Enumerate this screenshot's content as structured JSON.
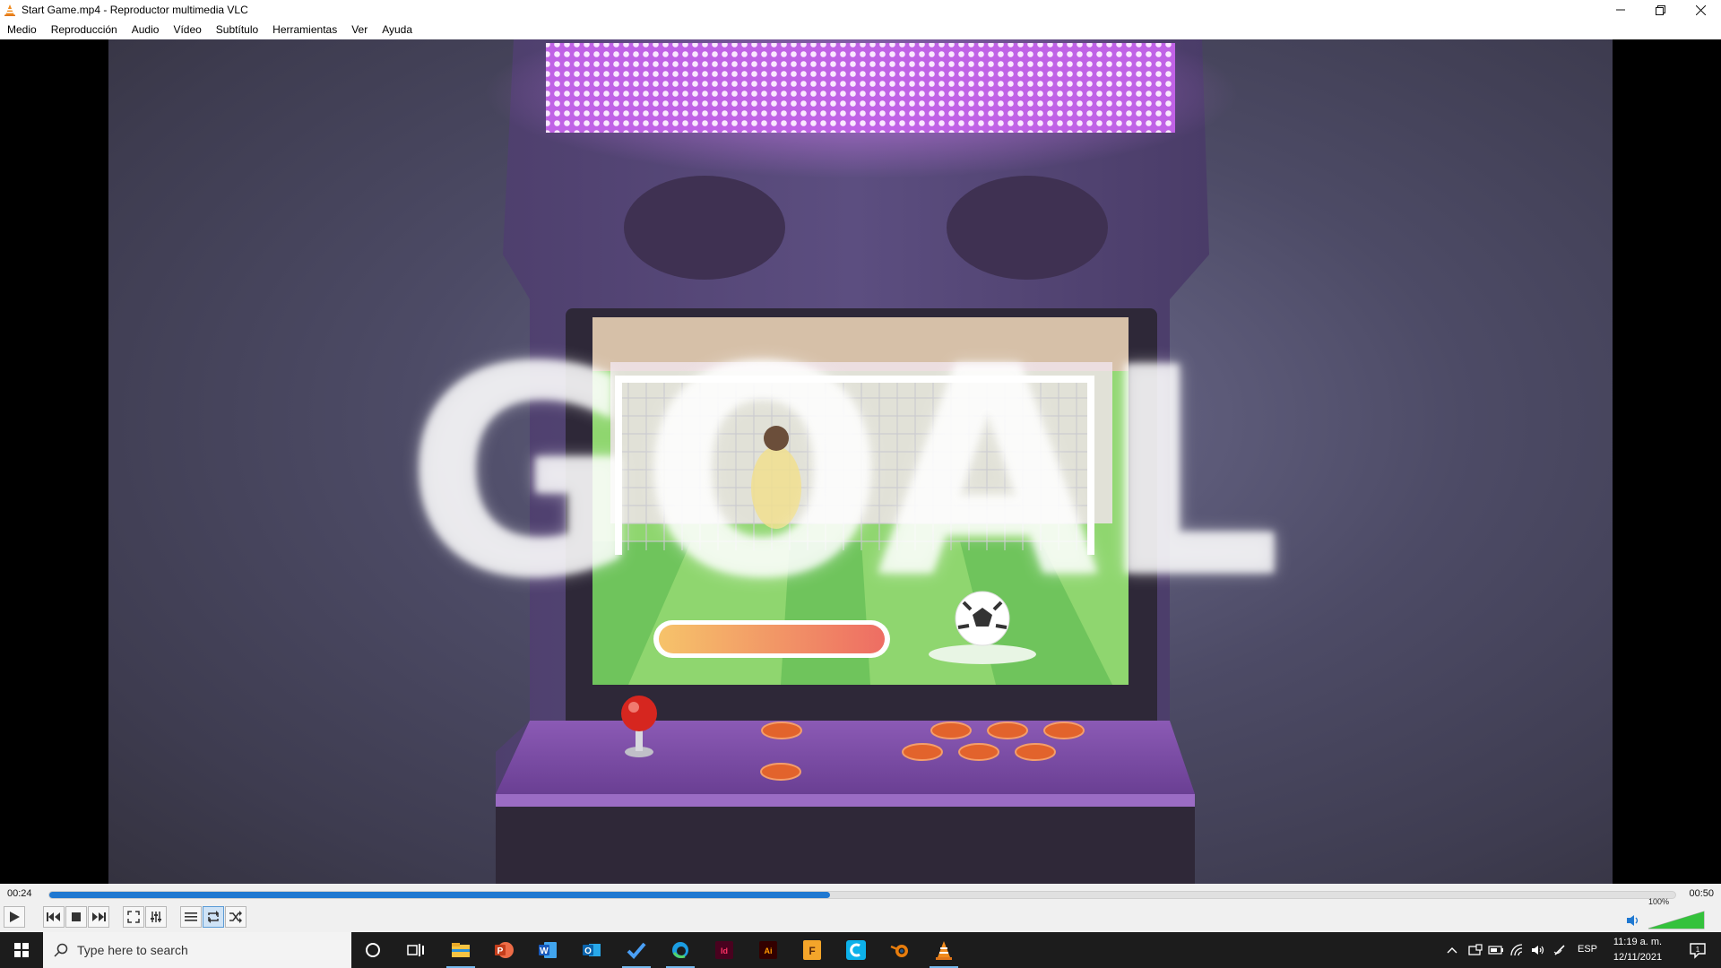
{
  "window": {
    "title": "Start Game.mp4 - Reproductor multimedia VLC",
    "controls": [
      "minimize-icon",
      "restore-icon",
      "close-icon"
    ]
  },
  "menu": [
    "Medio",
    "Reproducción",
    "Audio",
    "Vídeo",
    "Subtítulo",
    "Herramientas",
    "Ver",
    "Ayuda"
  ],
  "video": {
    "overlay_text": "GOAL",
    "description_colors": {
      "marquee": "#d77cf0",
      "screen_grass": "#7fd36b",
      "power_bar": "#f0806a"
    }
  },
  "player": {
    "time_elapsed": "00:24",
    "time_total": "00:50",
    "progress": 0.48,
    "volume_label": "100%",
    "volume": 1.0,
    "buttons": [
      "play-icon",
      "prev-icon",
      "stop-icon",
      "next-icon",
      "fullscreen-icon",
      "extended-settings-icon",
      "playlist-icon",
      "loop-icon",
      "shuffle-icon",
      "speaker-icon"
    ],
    "accent": "#1f78d1"
  },
  "taskbar": {
    "search_placeholder": "Type here to search",
    "apps": [
      "cortana-icon",
      "task-view-icon",
      "file-explorer-icon",
      "powerpoint-icon",
      "word-icon",
      "outlook-icon",
      "todo-icon",
      "edge-icon",
      "indesign-icon",
      "illustrator-icon",
      "figma-icon",
      "c-app-icon",
      "blender-icon",
      "vlc-icon"
    ],
    "language": "ESP",
    "time": "11:19 a. m.",
    "date": "12/11/2021",
    "notification_count": "1"
  }
}
